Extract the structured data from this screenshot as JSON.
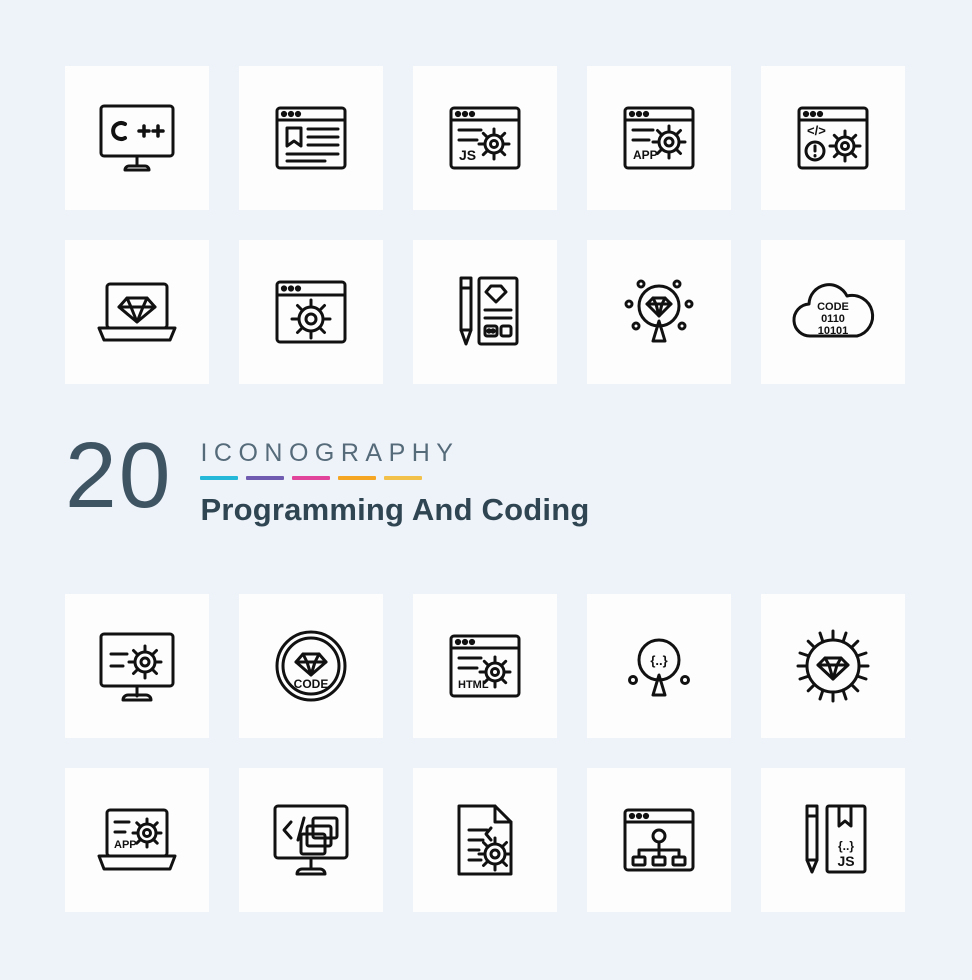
{
  "background_color": "#eef3fa",
  "tile_color": "#fdfdfe",
  "stroke_color": "#111111",
  "title": {
    "number": "20",
    "kicker": "ICONOGRAPHY",
    "subtitle": "Programming And Coding",
    "number_color": "#3f5463",
    "kicker_color": "#566b7a",
    "subtitle_color": "#2f4552",
    "dash_colors": [
      "#25b8d8",
      "#6f5bb0",
      "#e0459b",
      "#f5a623",
      "#f2c14a"
    ]
  },
  "rows": [
    {
      "id": "row-1",
      "icons": [
        {
          "name": "monitor-cpp-icon",
          "label": "C++"
        },
        {
          "name": "browser-bookmark-code-icon",
          "label": ""
        },
        {
          "name": "browser-js-gear-icon",
          "label": "JS"
        },
        {
          "name": "browser-app-gear-icon",
          "label": "APP"
        },
        {
          "name": "browser-code-alert-gear-icon",
          "label": "</>"
        }
      ]
    },
    {
      "id": "row-2",
      "icons": [
        {
          "name": "laptop-diamond-icon",
          "label": ""
        },
        {
          "name": "browser-gear-icon",
          "label": ""
        },
        {
          "name": "design-tools-diamond-icon",
          "label": ""
        },
        {
          "name": "search-diamond-icon",
          "label": ""
        },
        {
          "name": "cloud-code-binary-icon",
          "label": "CODE",
          "label2": "0110",
          "label3": "10101"
        }
      ]
    },
    {
      "id": "row-3",
      "icons": [
        {
          "name": "monitor-gear-icon",
          "label": ""
        },
        {
          "name": "badge-diamond-code-icon",
          "label": "CODE"
        },
        {
          "name": "browser-html-gear-icon",
          "label": "HTML"
        },
        {
          "name": "search-code-brackets-icon",
          "label": "{..}"
        },
        {
          "name": "gear-diamond-icon",
          "label": ""
        }
      ]
    },
    {
      "id": "row-4",
      "icons": [
        {
          "name": "laptop-app-gear-icon",
          "label": "APP"
        },
        {
          "name": "monitor-code-layers-icon",
          "label": ""
        },
        {
          "name": "document-code-gear-icon",
          "label": ""
        },
        {
          "name": "browser-sitemap-icon",
          "label": ""
        },
        {
          "name": "bookmark-pencil-js-icon",
          "label": "JS",
          "label2": "{..}"
        }
      ]
    }
  ]
}
